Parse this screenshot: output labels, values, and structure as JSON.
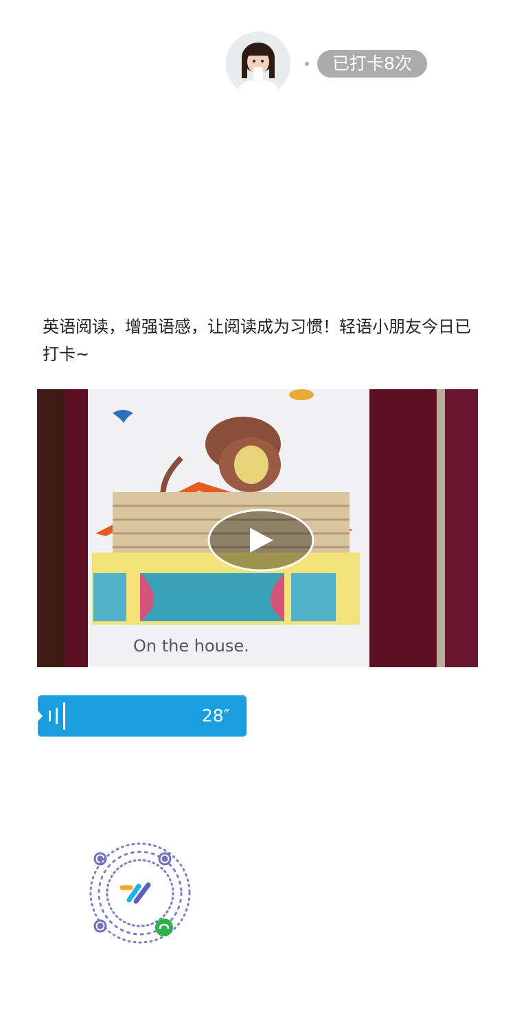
{
  "header": {
    "avatar_icon": "child-avatar-icon",
    "checkin_badge": "已打卡8次"
  },
  "post": {
    "caption": "英语阅读，增强语感，让阅读成为习惯！轻语小朋友今日已打卡~",
    "video": {
      "thumbnail_text": "On the house.",
      "play_icon": "play-icon"
    },
    "voice": {
      "duration": "28″",
      "color": "#1a9ee0"
    }
  },
  "footer": {
    "qr_icon": "mini-program-qr-code-icon"
  }
}
